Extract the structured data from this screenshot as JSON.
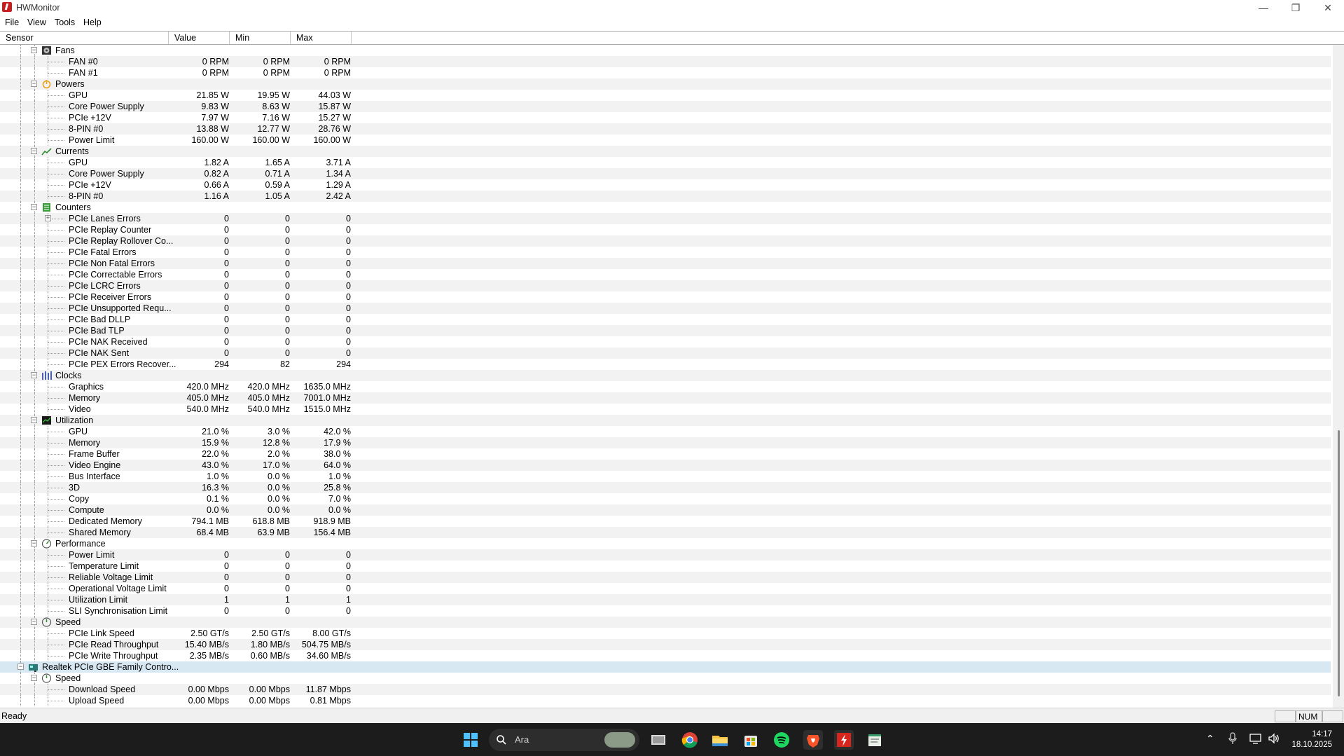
{
  "window": {
    "title": "HWMonitor",
    "minimize_icon": "minimize-icon",
    "maximize_icon": "restore-icon",
    "close_icon": "close-icon"
  },
  "menu": [
    "File",
    "View",
    "Tools",
    "Help"
  ],
  "columns": [
    "Sensor",
    "Value",
    "Min",
    "Max"
  ],
  "rows": [
    {
      "t": "g",
      "label": "Fans",
      "icon": "fan-icon",
      "exp": "-"
    },
    {
      "t": "s",
      "label": "FAN #0",
      "v": [
        "0 RPM",
        "0 RPM",
        "0 RPM"
      ]
    },
    {
      "t": "s",
      "label": "FAN #1",
      "v": [
        "0 RPM",
        "0 RPM",
        "0 RPM"
      ]
    },
    {
      "t": "g",
      "label": "Powers",
      "icon": "power-icon",
      "exp": "-"
    },
    {
      "t": "s",
      "label": "GPU",
      "v": [
        "21.85 W",
        "19.95 W",
        "44.03 W"
      ]
    },
    {
      "t": "s",
      "label": "Core Power Supply",
      "v": [
        "9.83 W",
        "8.63 W",
        "15.87 W"
      ]
    },
    {
      "t": "s",
      "label": "PCIe +12V",
      "v": [
        "7.97 W",
        "7.16 W",
        "15.27 W"
      ]
    },
    {
      "t": "s",
      "label": "8-PIN #0",
      "v": [
        "13.88 W",
        "12.77 W",
        "28.76 W"
      ]
    },
    {
      "t": "s",
      "label": "Power Limit",
      "v": [
        "160.00 W",
        "160.00 W",
        "160.00 W"
      ]
    },
    {
      "t": "g",
      "label": "Currents",
      "icon": "current-icon",
      "exp": "-"
    },
    {
      "t": "s",
      "label": "GPU",
      "v": [
        "1.82 A",
        "1.65 A",
        "3.71 A"
      ]
    },
    {
      "t": "s",
      "label": "Core Power Supply",
      "v": [
        "0.82 A",
        "0.71 A",
        "1.34 A"
      ]
    },
    {
      "t": "s",
      "label": "PCIe +12V",
      "v": [
        "0.66 A",
        "0.59 A",
        "1.29 A"
      ]
    },
    {
      "t": "s",
      "label": "8-PIN #0",
      "v": [
        "1.16 A",
        "1.05 A",
        "2.42 A"
      ]
    },
    {
      "t": "g",
      "label": "Counters",
      "icon": "counter-icon",
      "exp": "-"
    },
    {
      "t": "s",
      "label": "PCIe Lanes Errors",
      "v": [
        "0",
        "0",
        "0"
      ],
      "exp": "+"
    },
    {
      "t": "s",
      "label": "PCIe Replay Counter",
      "v": [
        "0",
        "0",
        "0"
      ]
    },
    {
      "t": "s",
      "label": "PCIe Replay Rollover Co...",
      "v": [
        "0",
        "0",
        "0"
      ]
    },
    {
      "t": "s",
      "label": "PCIe Fatal Errors",
      "v": [
        "0",
        "0",
        "0"
      ]
    },
    {
      "t": "s",
      "label": "PCIe Non Fatal Errors",
      "v": [
        "0",
        "0",
        "0"
      ]
    },
    {
      "t": "s",
      "label": "PCIe Correctable Errors",
      "v": [
        "0",
        "0",
        "0"
      ]
    },
    {
      "t": "s",
      "label": "PCIe LCRC Errors",
      "v": [
        "0",
        "0",
        "0"
      ]
    },
    {
      "t": "s",
      "label": "PCIe Receiver Errors",
      "v": [
        "0",
        "0",
        "0"
      ]
    },
    {
      "t": "s",
      "label": "PCIe Unsupported Requ...",
      "v": [
        "0",
        "0",
        "0"
      ]
    },
    {
      "t": "s",
      "label": "PCIe Bad DLLP",
      "v": [
        "0",
        "0",
        "0"
      ]
    },
    {
      "t": "s",
      "label": "PCIe Bad TLP",
      "v": [
        "0",
        "0",
        "0"
      ]
    },
    {
      "t": "s",
      "label": "PCIe NAK Received",
      "v": [
        "0",
        "0",
        "0"
      ]
    },
    {
      "t": "s",
      "label": "PCIe NAK Sent",
      "v": [
        "0",
        "0",
        "0"
      ]
    },
    {
      "t": "s",
      "label": "PCIe PEX Errors Recover...",
      "v": [
        "294",
        "82",
        "294"
      ]
    },
    {
      "t": "g",
      "label": "Clocks",
      "icon": "clock-icon",
      "exp": "-"
    },
    {
      "t": "s",
      "label": "Graphics",
      "v": [
        "420.0 MHz",
        "420.0 MHz",
        "1635.0 MHz"
      ]
    },
    {
      "t": "s",
      "label": "Memory",
      "v": [
        "405.0 MHz",
        "405.0 MHz",
        "7001.0 MHz"
      ]
    },
    {
      "t": "s",
      "label": "Video",
      "v": [
        "540.0 MHz",
        "540.0 MHz",
        "1515.0 MHz"
      ]
    },
    {
      "t": "g",
      "label": "Utilization",
      "icon": "utilization-icon",
      "exp": "-"
    },
    {
      "t": "s",
      "label": "GPU",
      "v": [
        "21.0 %",
        "3.0 %",
        "42.0 %"
      ]
    },
    {
      "t": "s",
      "label": "Memory",
      "v": [
        "15.9 %",
        "12.8 %",
        "17.9 %"
      ]
    },
    {
      "t": "s",
      "label": "Frame Buffer",
      "v": [
        "22.0 %",
        "2.0 %",
        "38.0 %"
      ]
    },
    {
      "t": "s",
      "label": "Video Engine",
      "v": [
        "43.0 %",
        "17.0 %",
        "64.0 %"
      ]
    },
    {
      "t": "s",
      "label": "Bus Interface",
      "v": [
        "1.0 %",
        "0.0 %",
        "1.0 %"
      ]
    },
    {
      "t": "s",
      "label": "3D",
      "v": [
        "16.3 %",
        "0.0 %",
        "25.8 %"
      ]
    },
    {
      "t": "s",
      "label": "Copy",
      "v": [
        "0.1 %",
        "0.0 %",
        "7.0 %"
      ]
    },
    {
      "t": "s",
      "label": "Compute",
      "v": [
        "0.0 %",
        "0.0 %",
        "0.0 %"
      ]
    },
    {
      "t": "s",
      "label": "Dedicated Memory",
      "v": [
        "794.1 MB",
        "618.8 MB",
        "918.9 MB"
      ]
    },
    {
      "t": "s",
      "label": "Shared Memory",
      "v": [
        "68.4 MB",
        "63.9 MB",
        "156.4 MB"
      ]
    },
    {
      "t": "g",
      "label": "Performance",
      "icon": "performance-icon",
      "exp": "-"
    },
    {
      "t": "s",
      "label": "Power Limit",
      "v": [
        "0",
        "0",
        "0"
      ]
    },
    {
      "t": "s",
      "label": "Temperature Limit",
      "v": [
        "0",
        "0",
        "0"
      ]
    },
    {
      "t": "s",
      "label": "Reliable Voltage Limit",
      "v": [
        "0",
        "0",
        "0"
      ]
    },
    {
      "t": "s",
      "label": "Operational Voltage Limit",
      "v": [
        "0",
        "0",
        "0"
      ]
    },
    {
      "t": "s",
      "label": "Utilization Limit",
      "v": [
        "1",
        "1",
        "1"
      ]
    },
    {
      "t": "s",
      "label": "SLI Synchronisation Limit",
      "v": [
        "0",
        "0",
        "0"
      ]
    },
    {
      "t": "g",
      "label": "Speed",
      "icon": "speed-icon",
      "exp": "-"
    },
    {
      "t": "s",
      "label": "PCIe Link Speed",
      "v": [
        "2.50 GT/s",
        "2.50 GT/s",
        "8.00 GT/s"
      ]
    },
    {
      "t": "s",
      "label": "PCIe Read Throughput",
      "v": [
        "15.40 MB/s",
        "1.80 MB/s",
        "504.75 MB/s"
      ]
    },
    {
      "t": "s",
      "label": "PCIe Write Throughput",
      "v": [
        "2.35 MB/s",
        "0.60 MB/s",
        "34.60 MB/s"
      ]
    },
    {
      "t": "d",
      "label": "Realtek PCIe GBE Family Contro...",
      "icon": "network-adapter-icon",
      "exp": "-",
      "selected": true
    },
    {
      "t": "g",
      "label": "Speed",
      "icon": "speed-icon",
      "exp": "-"
    },
    {
      "t": "s",
      "label": "Download Speed",
      "v": [
        "0.00 Mbps",
        "0.00 Mbps",
        "11.87 Mbps"
      ]
    },
    {
      "t": "s",
      "label": "Upload Speed",
      "v": [
        "0.00 Mbps",
        "0.00 Mbps",
        "0.81 Mbps"
      ]
    }
  ],
  "status": {
    "text": "Ready",
    "num": "NUM"
  },
  "taskbar": {
    "search_placeholder": "Ara",
    "time": "14:17",
    "date": "18.10.2025",
    "apps": [
      "windows-start-icon",
      "task-view-icon",
      "chrome-icon",
      "file-explorer-icon",
      "store-icon",
      "spotify-icon",
      "brave-icon",
      "hwmonitor-icon",
      "notepad-icon"
    ],
    "tray": [
      "chevron-up-icon",
      "microphone-icon",
      "network-icon",
      "volume-icon"
    ]
  },
  "colors": {
    "selected_row": "#d8e8f3",
    "alt_row": "#f2f2f2",
    "taskbar": "#1c1c1c"
  }
}
